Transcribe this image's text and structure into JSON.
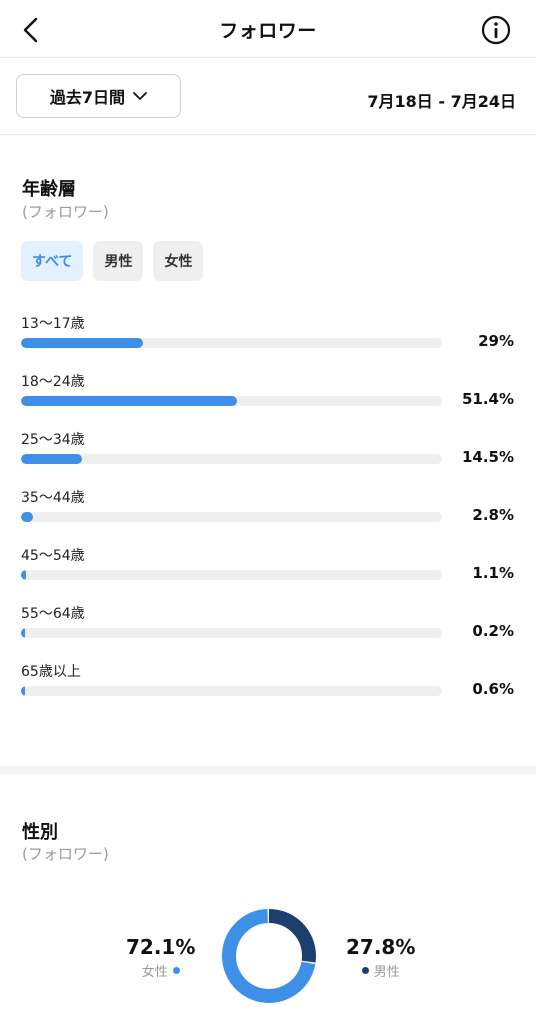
{
  "header": {
    "title": "フォロワー"
  },
  "period": {
    "label": "過去7日間",
    "date_range": "7月18日 - 7月24日"
  },
  "age_section": {
    "title": "年齢層",
    "subtitle": "(フォロワー)",
    "filters": [
      {
        "label": "すべて",
        "active": true
      },
      {
        "label": "男性",
        "active": false
      },
      {
        "label": "女性",
        "active": false
      }
    ],
    "rows": [
      {
        "label": "13〜17歳",
        "value": "29%",
        "percent": 29
      },
      {
        "label": "18〜24歳",
        "value": "51.4%",
        "percent": 51.4
      },
      {
        "label": "25〜34歳",
        "value": "14.5%",
        "percent": 14.5
      },
      {
        "label": "35〜44歳",
        "value": "2.8%",
        "percent": 2.8
      },
      {
        "label": "45〜54歳",
        "value": "1.1%",
        "percent": 1.1
      },
      {
        "label": "55〜64歳",
        "value": "0.2%",
        "percent": 0.2
      },
      {
        "label": "65歳以上",
        "value": "0.6%",
        "percent": 0.6
      }
    ]
  },
  "gender_section": {
    "title": "性別",
    "subtitle": "(フォロワー)",
    "female": {
      "value": "72.1%",
      "label": "女性",
      "percent": 72.1
    },
    "male": {
      "value": "27.8%",
      "label": "男性",
      "percent": 27.8
    }
  },
  "colors": {
    "accent": "#3d8fe8",
    "male": "#1c3f6e",
    "track": "#efefef"
  }
}
